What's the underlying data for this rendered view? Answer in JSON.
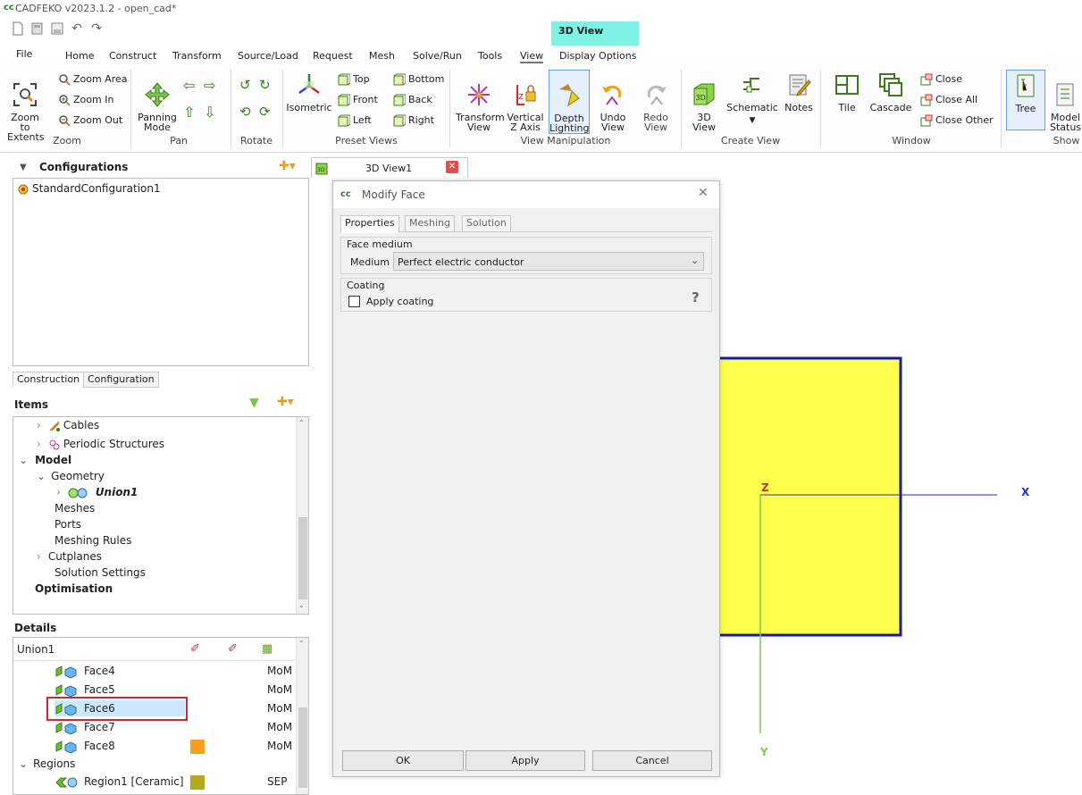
{
  "window": {
    "title": "CADFEKO v2023.1.2 - open_cad*",
    "logo_text": "cc"
  },
  "context_tab": "3D View",
  "menu_tabs": [
    "File",
    "Home",
    "Construct",
    "Transform",
    "Source/Load",
    "Request",
    "Mesh",
    "Solve/Run",
    "Tools",
    "View",
    "Display Options"
  ],
  "ribbon": {
    "zoom": {
      "label": "Zoom",
      "zoom_to_extents": "Zoom to\nExtents",
      "zoom_area": "Zoom Area",
      "zoom_in": "Zoom In",
      "zoom_out": "Zoom Out"
    },
    "pan": {
      "label": "Pan",
      "panning_mode": "Panning\nMode"
    },
    "rotate": {
      "label": "Rotate"
    },
    "preset": {
      "label": "Preset Views",
      "isometric": "Isometric",
      "top": "Top",
      "bottom": "Bottom",
      "front": "Front",
      "back": "Back",
      "left": "Left",
      "right": "Right"
    },
    "viewmanip": {
      "label": "View Manipulation",
      "transform_view": "Transform\nView",
      "vertical_z": "Vertical\nZ Axis",
      "depth_lighting": "Depth\nLighting",
      "undo_view": "Undo\nView",
      "redo_view": "Redo\nView"
    },
    "createview": {
      "label": "Create View",
      "view3d": "3D\nView",
      "schematic": "Schematic",
      "notes": "Notes"
    },
    "window": {
      "label": "Window",
      "tile": "Tile",
      "cascade": "Cascade",
      "close": "Close",
      "close_all": "Close All",
      "close_other": "Close Other"
    },
    "show": {
      "label": "Show",
      "tree": "Tree",
      "model_status": "Model\nStatus"
    }
  },
  "configurations": {
    "title": "Configurations",
    "items": [
      "StandardConfiguration1"
    ]
  },
  "left_tabs": [
    "Construction",
    "Configuration"
  ],
  "items": {
    "title": "Items",
    "rows": [
      "Cables",
      "Periodic Structures",
      "Model",
      "Geometry",
      "Union1",
      "Meshes",
      "Ports",
      "Meshing Rules",
      "Cutplanes",
      "Solution Settings",
      "Optimisation"
    ]
  },
  "details": {
    "title": "Details",
    "header": "Union1",
    "rows": [
      {
        "name": "Face4",
        "solver": "MoM"
      },
      {
        "name": "Face5",
        "solver": "MoM"
      },
      {
        "name": "Face6",
        "solver": "MoM"
      },
      {
        "name": "Face7",
        "solver": "MoM"
      },
      {
        "name": "Face8",
        "solver": "MoM"
      }
    ],
    "regions_label": "Regions",
    "region": {
      "name": "Region1 [Ceramic]",
      "solver": "SEP"
    }
  },
  "doc_tab": "3D View1",
  "dialog": {
    "title": "Modify Face",
    "tabs": [
      "Properties",
      "Meshing",
      "Solution"
    ],
    "face_medium_label": "Face medium",
    "medium_label": "Medium",
    "medium_value": "Perfect electric conductor",
    "coating_label": "Coating",
    "apply_coating_label": "Apply coating",
    "apply_coating_checked": false,
    "help": "?",
    "ok": "OK",
    "apply": "Apply",
    "cancel": "Cancel"
  },
  "viewport": {
    "axis_x": "X",
    "axis_y": "Y",
    "axis_z": "Z",
    "plate_color": "#ffff4d",
    "edge_color": "#1a1aa8"
  }
}
